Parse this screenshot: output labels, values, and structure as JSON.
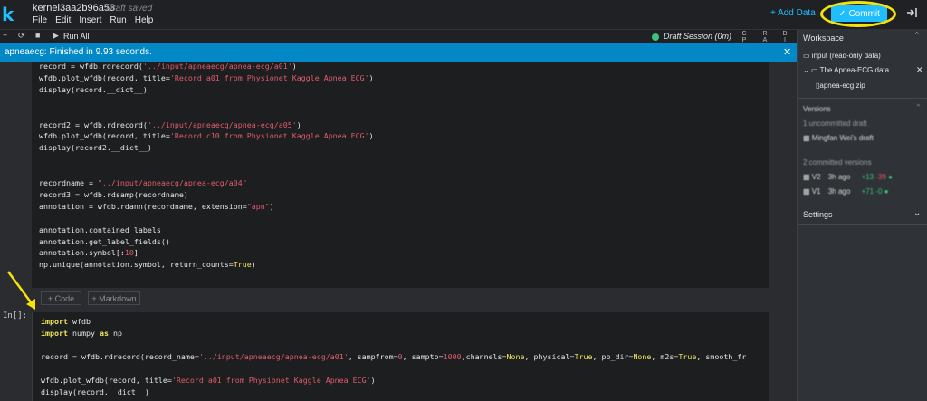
{
  "header": {
    "logo": "k",
    "kernel_title": "kernel3aa2b96a53",
    "draft_status": "Draft saved",
    "menu": [
      "File",
      "Edit",
      "Insert",
      "Run",
      "Help"
    ],
    "add_data_label": "+ Add Data",
    "commit_label": "Commit"
  },
  "toolbar": {
    "run_all_label": "Run All",
    "session_label": "Draft Session (0m)",
    "view_buttons": [
      [
        "C",
        "P",
        "U"
      ],
      [
        "R",
        "A",
        "M"
      ],
      [
        "D",
        "I",
        "S"
      ]
    ]
  },
  "notification": {
    "text": "apneaecg: Finished in 9.93 seconds.",
    "close": "✕"
  },
  "cells": {
    "cell1_lines": [
      [
        {
          "t": "record = wfdb.rdrecord("
        },
        {
          "t": "'../input/apneaecg/apnea-ecg/a01'",
          "c": "str"
        },
        {
          "t": ")"
        }
      ],
      [
        {
          "t": "wfdb.plot_wfdb(record, title="
        },
        {
          "t": "'Record a01 from Physionet Kaggle Apnea ECG'",
          "c": "str"
        },
        {
          "t": ")"
        }
      ],
      [
        {
          "t": "display(record.__dict__)"
        }
      ],
      [],
      [],
      [
        {
          "t": "record2 = wfdb.rdrecord("
        },
        {
          "t": "'../input/apneaecg/apnea-ecg/a05'",
          "c": "str"
        },
        {
          "t": ")"
        }
      ],
      [
        {
          "t": "wfdb.plot_wfdb(record, title="
        },
        {
          "t": "'Record c10 from Physionet Kaggle Apnea ECG'",
          "c": "str"
        },
        {
          "t": ")"
        }
      ],
      [
        {
          "t": "display(record2.__dict__)"
        }
      ],
      [],
      [],
      [
        {
          "t": "recordname = "
        },
        {
          "t": "\"../input/apneaecg/apnea-ecg/a04\"",
          "c": "str"
        }
      ],
      [
        {
          "t": "record3 = wfdb.rdsamp(recordname)"
        }
      ],
      [
        {
          "t": "annotation = wfdb.rdann(recordname, extension="
        },
        {
          "t": "\"apn\"",
          "c": "str"
        },
        {
          "t": ")"
        }
      ],
      [],
      [
        {
          "t": "annotation.contained_labels"
        }
      ],
      [
        {
          "t": "annotation.get_label_fields()"
        }
      ],
      [
        {
          "t": "annotation.symbol[:"
        },
        {
          "t": "10",
          "c": "num"
        },
        {
          "t": "]"
        }
      ],
      [
        {
          "t": "np.unique(annotation.symbol, return_counts="
        },
        {
          "t": "True",
          "c": "bool"
        },
        {
          "t": ")"
        }
      ]
    ],
    "add_code_label": "+ Code",
    "add_markdown_label": "+ Markdown",
    "prompt": "In[]:",
    "cell2_lines": [
      [
        {
          "t": "import",
          "c": "kw"
        },
        {
          "t": " wfdb"
        }
      ],
      [
        {
          "t": "import",
          "c": "kw"
        },
        {
          "t": " numpy "
        },
        {
          "t": "as",
          "c": "kw"
        },
        {
          "t": " np"
        }
      ],
      [],
      [
        {
          "t": "record = wfdb.rdrecord(record_name="
        },
        {
          "t": "'../input/apneaecg/apnea-ecg/a01'",
          "c": "str"
        },
        {
          "t": ", sampfrom="
        },
        {
          "t": "0",
          "c": "num"
        },
        {
          "t": ", sampto="
        },
        {
          "t": "1000",
          "c": "num"
        },
        {
          "t": ",channels="
        },
        {
          "t": "None",
          "c": "bool"
        },
        {
          "t": ", physical="
        },
        {
          "t": "True",
          "c": "bool"
        },
        {
          "t": ", pb_dir="
        },
        {
          "t": "None",
          "c": "bool"
        },
        {
          "t": ", m2s="
        },
        {
          "t": "True",
          "c": "bool"
        },
        {
          "t": ", smooth_fr"
        }
      ],
      [],
      [
        {
          "t": "wfdb.plot_wfdb(record, title="
        },
        {
          "t": "'Record a01 from Physionet Kaggle Apnea ECG'",
          "c": "str"
        },
        {
          "t": ")"
        }
      ],
      [
        {
          "t": "display(record.__dict__)"
        }
      ]
    ]
  },
  "sidebar": {
    "workspace_title": "Workspace",
    "input_label": "input (read-only data)",
    "dataset_label": "The Apnea-ECG data...",
    "file_label": "apnea-ecg.zip",
    "versions_title": "Versions",
    "uncommitted_label": "1 uncommitted draft",
    "draft_owner": "Mingfan Wei's draft",
    "committed_label": "2 committed versions",
    "versions": [
      {
        "name": "V2",
        "time": "3h ago",
        "plus": "+13",
        "minus": "-39"
      },
      {
        "name": "V1",
        "time": "3h ago",
        "plus": "+71",
        "minus": "-0"
      }
    ],
    "settings_title": "Settings"
  },
  "colors": {
    "accent": "#20beff",
    "notification": "#0288c7",
    "highlight_ring": "#f4e30b",
    "session_ok": "#3ec37a"
  }
}
